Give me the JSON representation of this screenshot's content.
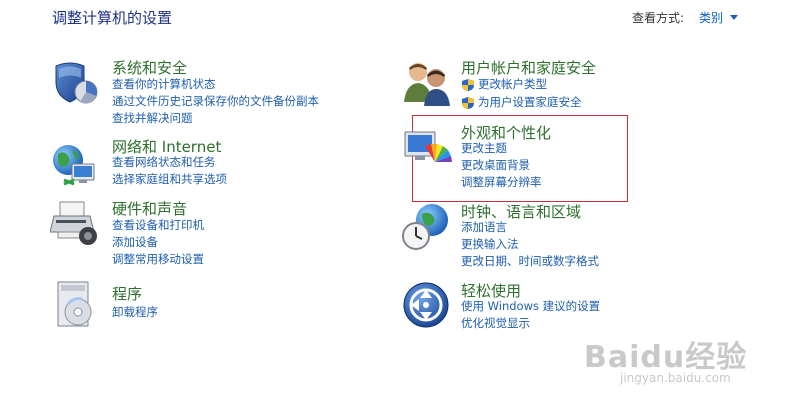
{
  "header": {
    "title": "调整计算机的设置",
    "view_by_label": "查看方式:",
    "view_by_value": "类别"
  },
  "categories": [
    {
      "title": "系统和安全",
      "icon": "system-security-icon",
      "links": [
        "查看你的计算机状态",
        "通过文件历史记录保存你的文件备份副本",
        "查找并解决问题"
      ]
    },
    {
      "title": "网络和 Internet",
      "icon": "network-internet-icon",
      "links": [
        "查看网络状态和任务",
        "选择家庭组和共享选项"
      ]
    },
    {
      "title": "硬件和声音",
      "icon": "hardware-sound-icon",
      "links": [
        "查看设备和打印机",
        "添加设备",
        "调整常用移动设置"
      ]
    },
    {
      "title": "程序",
      "icon": "programs-icon",
      "links": [
        "卸载程序"
      ]
    },
    {
      "title": "用户帐户和家庭安全",
      "icon": "user-accounts-icon",
      "links": [
        "更改帐户类型",
        "为用户设置家庭安全"
      ]
    },
    {
      "title": "外观和个性化",
      "icon": "appearance-personalization-icon",
      "links": [
        "更改主题",
        "更改桌面背景",
        "调整屏幕分辨率"
      ]
    },
    {
      "title": "时钟、语言和区域",
      "icon": "clock-language-region-icon",
      "links": [
        "添加语言",
        "更换输入法",
        "更改日期、时间或数字格式"
      ]
    },
    {
      "title": "轻松使用",
      "icon": "ease-of-access-icon",
      "links": [
        "使用 Windows 建议的设置",
        "优化视觉显示"
      ]
    }
  ],
  "watermark": {
    "text": "Baidu经验",
    "sub": "jingyan.baidu.com"
  },
  "colors": {
    "title_blue": "#1e3287",
    "link_blue": "#1f5fb0",
    "category_green": "#2f6f2f",
    "highlight_red": "#c8303a"
  }
}
